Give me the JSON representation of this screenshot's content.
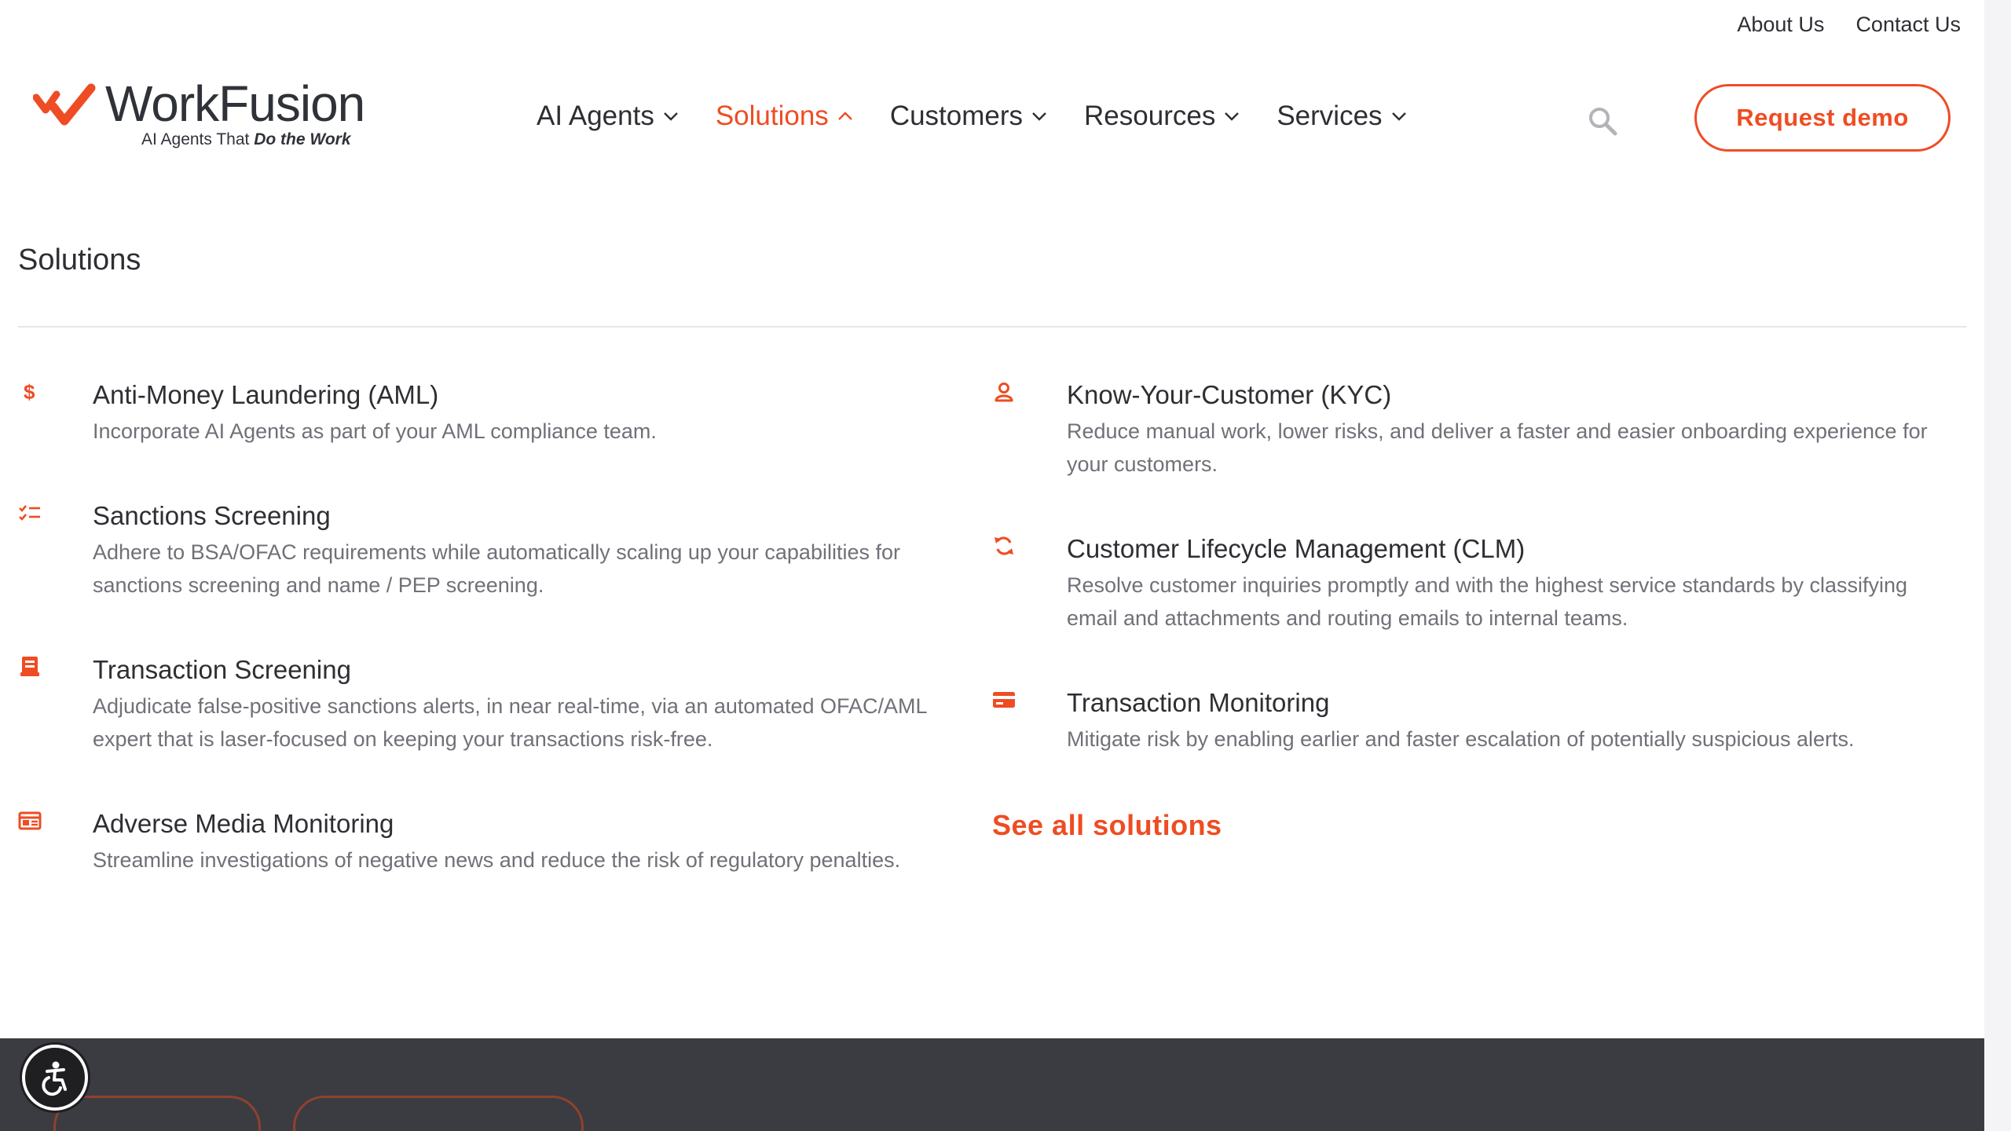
{
  "utility_nav": {
    "about": "About Us",
    "contact": "Contact Us"
  },
  "logo": {
    "word": "WorkFusion",
    "tagline_prefix": "AI Agents That ",
    "tagline_emphasis": "Do the Work"
  },
  "main_nav": {
    "items": [
      {
        "label": "AI Agents",
        "state": "collapsed"
      },
      {
        "label": "Solutions",
        "state": "expanded"
      },
      {
        "label": "Customers",
        "state": "collapsed"
      },
      {
        "label": "Resources",
        "state": "collapsed"
      },
      {
        "label": "Services",
        "state": "collapsed"
      }
    ],
    "request_demo": "Request demo"
  },
  "solutions": {
    "heading": "Solutions",
    "left": [
      {
        "icon": "dollar-icon",
        "title": "Anti-Money Laundering (AML)",
        "desc": "Incorporate AI Agents as part of your AML compliance team."
      },
      {
        "icon": "checklist-icon",
        "title": "Sanctions Screening",
        "desc": "Adhere to BSA/OFAC requirements while automatically scaling up your capabilities for sanctions screening and name / PEP screening."
      },
      {
        "icon": "receipt-icon",
        "title": "Transaction Screening",
        "desc": "Adjudicate false-positive sanctions alerts, in near real-time, via an automated OFAC/AML expert that is laser-focused on keeping your transactions risk-free."
      },
      {
        "icon": "newspaper-icon",
        "title": "Adverse Media Monitoring",
        "desc": "Streamline investigations of negative news and reduce the risk of regulatory penalties."
      }
    ],
    "right": [
      {
        "icon": "user-icon",
        "title": "Know-Your-Customer (KYC)",
        "desc": "Reduce manual work, lower risks, and deliver a faster and easier onboarding experience for your customers."
      },
      {
        "icon": "refresh-icon",
        "title": "Customer Lifecycle Management (CLM)",
        "desc": "Resolve customer inquiries promptly and with the highest service standards by classifying email and attachments and routing emails to internal teams."
      },
      {
        "icon": "credit-card-icon",
        "title": "Transaction Monitoring",
        "desc": "Mitigate risk by enabling earlier and faster escalation of potentially suspicious alerts."
      }
    ],
    "see_all": "See all solutions"
  },
  "colors": {
    "accent": "#ef4c23",
    "text": "#2e2e33",
    "muted": "#707078",
    "footer": "#3b3c41"
  }
}
